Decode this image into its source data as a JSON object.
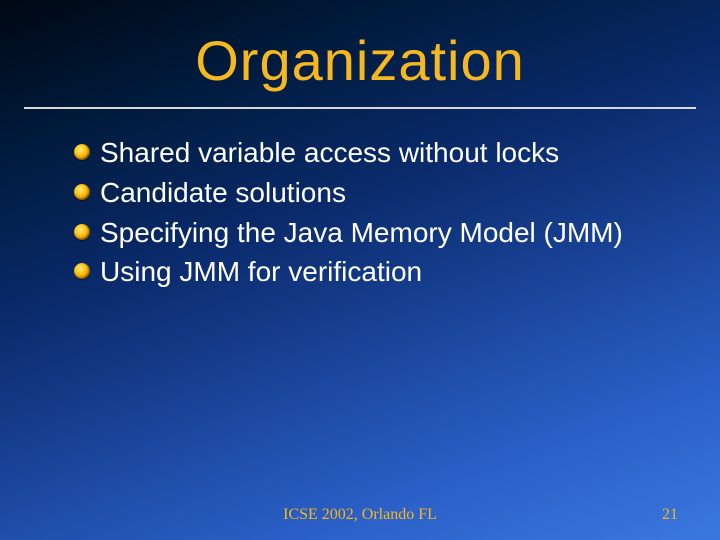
{
  "title": "Organization",
  "bullets": [
    "Shared variable access without locks",
    "Candidate solutions",
    "Specifying the Java Memory Model (JMM)",
    "Using JMM for verification"
  ],
  "footer": {
    "center": "ICSE 2002, Orlando FL",
    "page": "21"
  }
}
